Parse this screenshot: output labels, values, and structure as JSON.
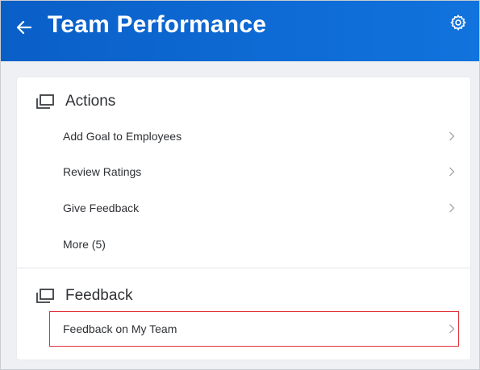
{
  "header": {
    "title": "Team Performance",
    "back_icon": "arrow-left-icon",
    "settings_icon": "gear-icon"
  },
  "actions": {
    "heading": "Actions",
    "icon": "stacked-windows-icon",
    "items": [
      {
        "label": "Add Goal to Employees",
        "has_chevron": true
      },
      {
        "label": "Review Ratings",
        "has_chevron": true
      },
      {
        "label": "Give Feedback",
        "has_chevron": true
      },
      {
        "label": "More (5)",
        "has_chevron": false
      }
    ]
  },
  "feedback": {
    "heading": "Feedback",
    "icon": "stacked-windows-icon",
    "items": [
      {
        "label": "Feedback on My Team",
        "has_chevron": true,
        "highlighted": true
      }
    ]
  },
  "colors": {
    "header_bg": "#0e6ad4",
    "highlight_border": "#e0303a",
    "page_bg": "#eef0f3"
  }
}
